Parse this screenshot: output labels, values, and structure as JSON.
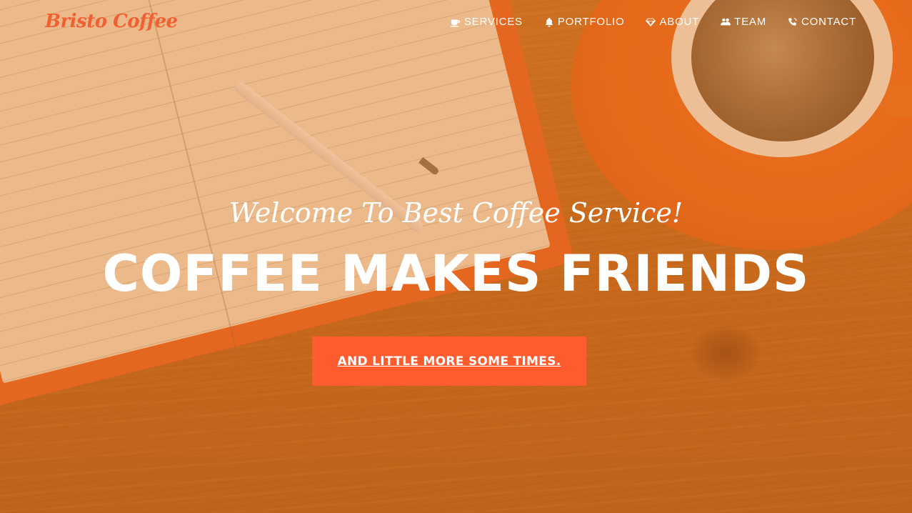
{
  "brand": {
    "name": "Bristo Coffee",
    "color": "#f06032"
  },
  "nav": {
    "items": [
      {
        "label": "SERVICES",
        "icon": "coffee-cup-icon"
      },
      {
        "label": "PORTFOLIO",
        "icon": "bell-icon"
      },
      {
        "label": "ABOUT",
        "icon": "diamond-icon"
      },
      {
        "label": "TEAM",
        "icon": "users-icon"
      },
      {
        "label": "CONTACT",
        "icon": "phone-icon"
      }
    ]
  },
  "hero": {
    "lead": "Welcome To Best Coffee Service!",
    "heading": "COFFEE MAKES FRIENDS",
    "cta_label": "AND LITTLE MORE SOME TIMES.",
    "accent_color": "#fe5c2e"
  }
}
